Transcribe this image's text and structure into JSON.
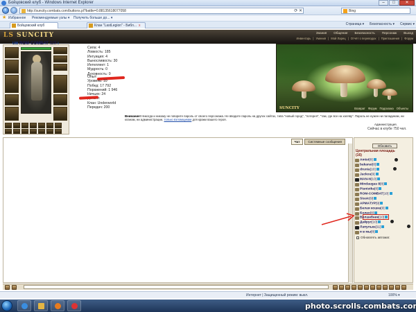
{
  "window": {
    "title": "Бойцовский клуб - Windows Internet Explorer"
  },
  "address": {
    "url": "http://suncity.combats.com/buttons.pl?battle=0.88135618077058",
    "search_engine": "Bing"
  },
  "favorites": {
    "label": "Избранное",
    "items": [
      "Рекомендуемые узлы ▾",
      "Получить больше до... ▾"
    ]
  },
  "tabs": [
    {
      "label": "Бойцовский клуб"
    },
    {
      "label": "Клан \"LastLegion\" - Библ..."
    }
  ],
  "command_bar": [
    "Страница ▾",
    "Безопасность ▾",
    "Сервис ▾"
  ],
  "site": {
    "logo_prefix": "LS",
    "logo": "SUNCITY",
    "menu_main": [
      "Знания",
      "Общение",
      "Безопасность",
      "Персонаж",
      "Выход"
    ],
    "menu_sub": [
      "Инвентарь",
      "Умения",
      "Мой Ларец",
      "Отчёт о переводах",
      "Приглашения",
      "Форум"
    ]
  },
  "character": {
    "clan_badge": "UW",
    "name": "ROM-COMBAT",
    "level": "[10]",
    "level_indicator": "i"
  },
  "stats": [
    "Сила: 4",
    "Ловкость: 185",
    "Интуиция: 4",
    "Выносливость: 30",
    "Интеллект: 1",
    "Мудрость: 0",
    "Духовность: 0"
  ],
  "stats2": [
    "Опыт:",
    "Уровень: 10",
    "Побед: 17 792",
    "Поражений: 1 946",
    "Ничьих: 24",
    "Деньги:",
    "Клан: Underworld",
    "Передач: 200"
  ],
  "scene": {
    "label": "SUNCITY",
    "links": [
      "Возврат",
      "Форум",
      "Подсказка",
      "Объекты"
    ]
  },
  "warning": {
    "bold": "Внимание!",
    "text": "Никогда и никому не говорите пароль от своего персонажа. Не вводите пароль на других сайтах, типа \"новый город\", \"лотерея\", \"там, где все на халяву\". Пароль не нужен ни паладинам, ни кланам, ни администрации,",
    "link": "только взломщикам",
    "text_after": "для кражи вашего героя.",
    "signature": "Администрация.",
    "online": "Сейчас в клубе 750 чел."
  },
  "chat": {
    "tabs": [
      "Чат",
      "Системные сообщения"
    ]
  },
  "online_list": {
    "refresh": "Обновить",
    "location": "Центральная площадь",
    "count": "(16)",
    "users": [
      {
        "name": "Amist",
        "level": "[8]"
      },
      {
        "name": "bakanai",
        "level": "[8]"
      },
      {
        "name": "drunia",
        "level": "[10]"
      },
      {
        "name": "Jackos",
        "level": "[9]"
      },
      {
        "name": "MAN-N",
        "level": "[10]"
      },
      {
        "name": "Mindaugas 8",
        "level": "[8]"
      },
      {
        "name": "Pianistka",
        "level": "[8]"
      },
      {
        "name": "ROM-COMBAT",
        "level": "[10]"
      },
      {
        "name": "Sissic",
        "level": "[9]"
      },
      {
        "name": "АРМАТУР",
        "level": "[9]"
      },
      {
        "name": "Белая кошка",
        "level": "[9]"
      },
      {
        "name": "Болео",
        "level": "[8]"
      },
      {
        "name": "Волшебник",
        "level": "[10]"
      },
      {
        "name": "Дайрус",
        "level": "[10]"
      },
      {
        "name": "Лапулька",
        "level": "[11]"
      },
      {
        "name": "я в мы",
        "level": "[8]"
      }
    ],
    "auto_refresh": "Обновлять автомат."
  },
  "statusbar": {
    "zone": "Интернет | Защищенный режим: выкл.",
    "zoom": "100% ▾"
  },
  "watermark": "photo.scrolls.combats.com",
  "colors": {
    "accent_red": "#e0271e",
    "site_header": "#2b2620",
    "panel_bg": "#f4efe1",
    "nick_color": "#1b1b5f"
  }
}
